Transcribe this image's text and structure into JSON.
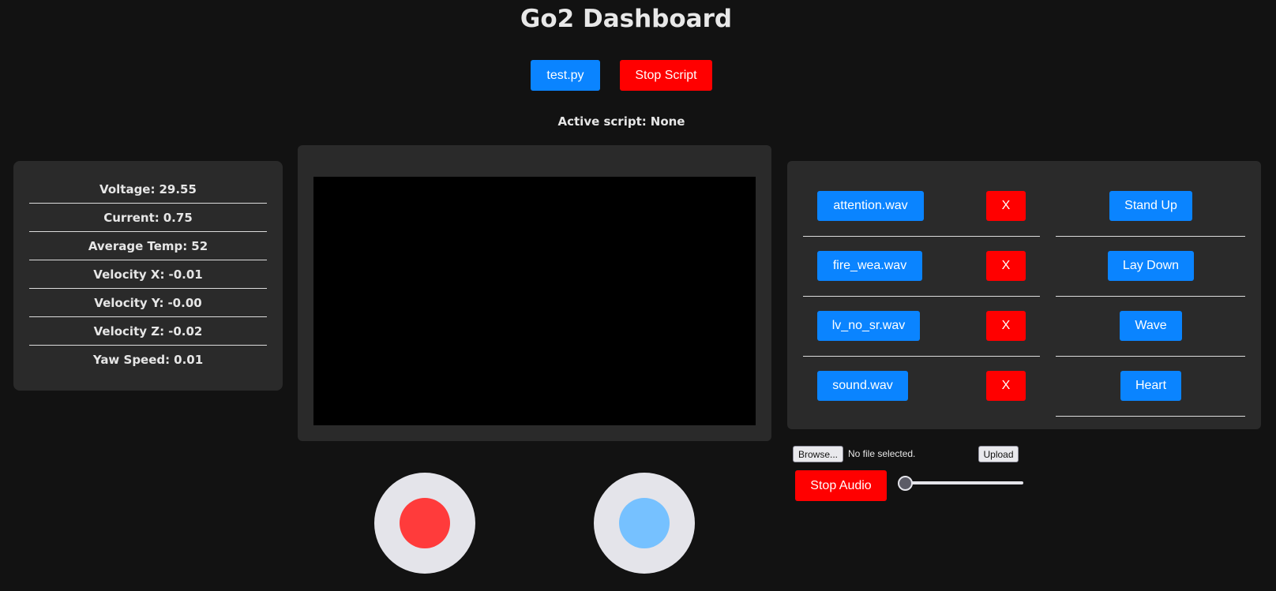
{
  "header": {
    "title": "Go2 Dashboard"
  },
  "scripts": {
    "items": [
      {
        "label": "test.py"
      }
    ],
    "stop_label": "Stop Script",
    "active_label": "Active script:",
    "active_value": "None"
  },
  "stats": [
    {
      "label": "Voltage:",
      "value": "29.55"
    },
    {
      "label": "Current:",
      "value": "0.75"
    },
    {
      "label": "Average Temp:",
      "value": "52"
    },
    {
      "label": "Velocity X:",
      "value": "-0.01"
    },
    {
      "label": "Velocity Y:",
      "value": "-0.00"
    },
    {
      "label": "Velocity Z:",
      "value": "-0.02"
    },
    {
      "label": "Yaw Speed:",
      "value": "0.01"
    }
  ],
  "audio": {
    "files": [
      {
        "name": "attention.wav",
        "delete_label": "X"
      },
      {
        "name": "fire_wea.wav",
        "delete_label": "X"
      },
      {
        "name": "lv_no_sr.wav",
        "delete_label": "X"
      },
      {
        "name": "sound.wav",
        "delete_label": "X"
      }
    ],
    "browse_label": "Browse...",
    "no_file_text": "No file selected.",
    "upload_label": "Upload",
    "stop_label": "Stop Audio",
    "volume_level": 0
  },
  "actions": [
    {
      "label": "Stand Up"
    },
    {
      "label": "Lay Down"
    },
    {
      "label": "Wave"
    },
    {
      "label": "Heart"
    }
  ],
  "joysticks": {
    "left_color": "#ff3b3b",
    "right_color": "#76c1ff"
  },
  "colors": {
    "primary": "#0a84ff",
    "danger": "#ff0000",
    "background": "#121212",
    "panel": "#2a2a2a"
  }
}
